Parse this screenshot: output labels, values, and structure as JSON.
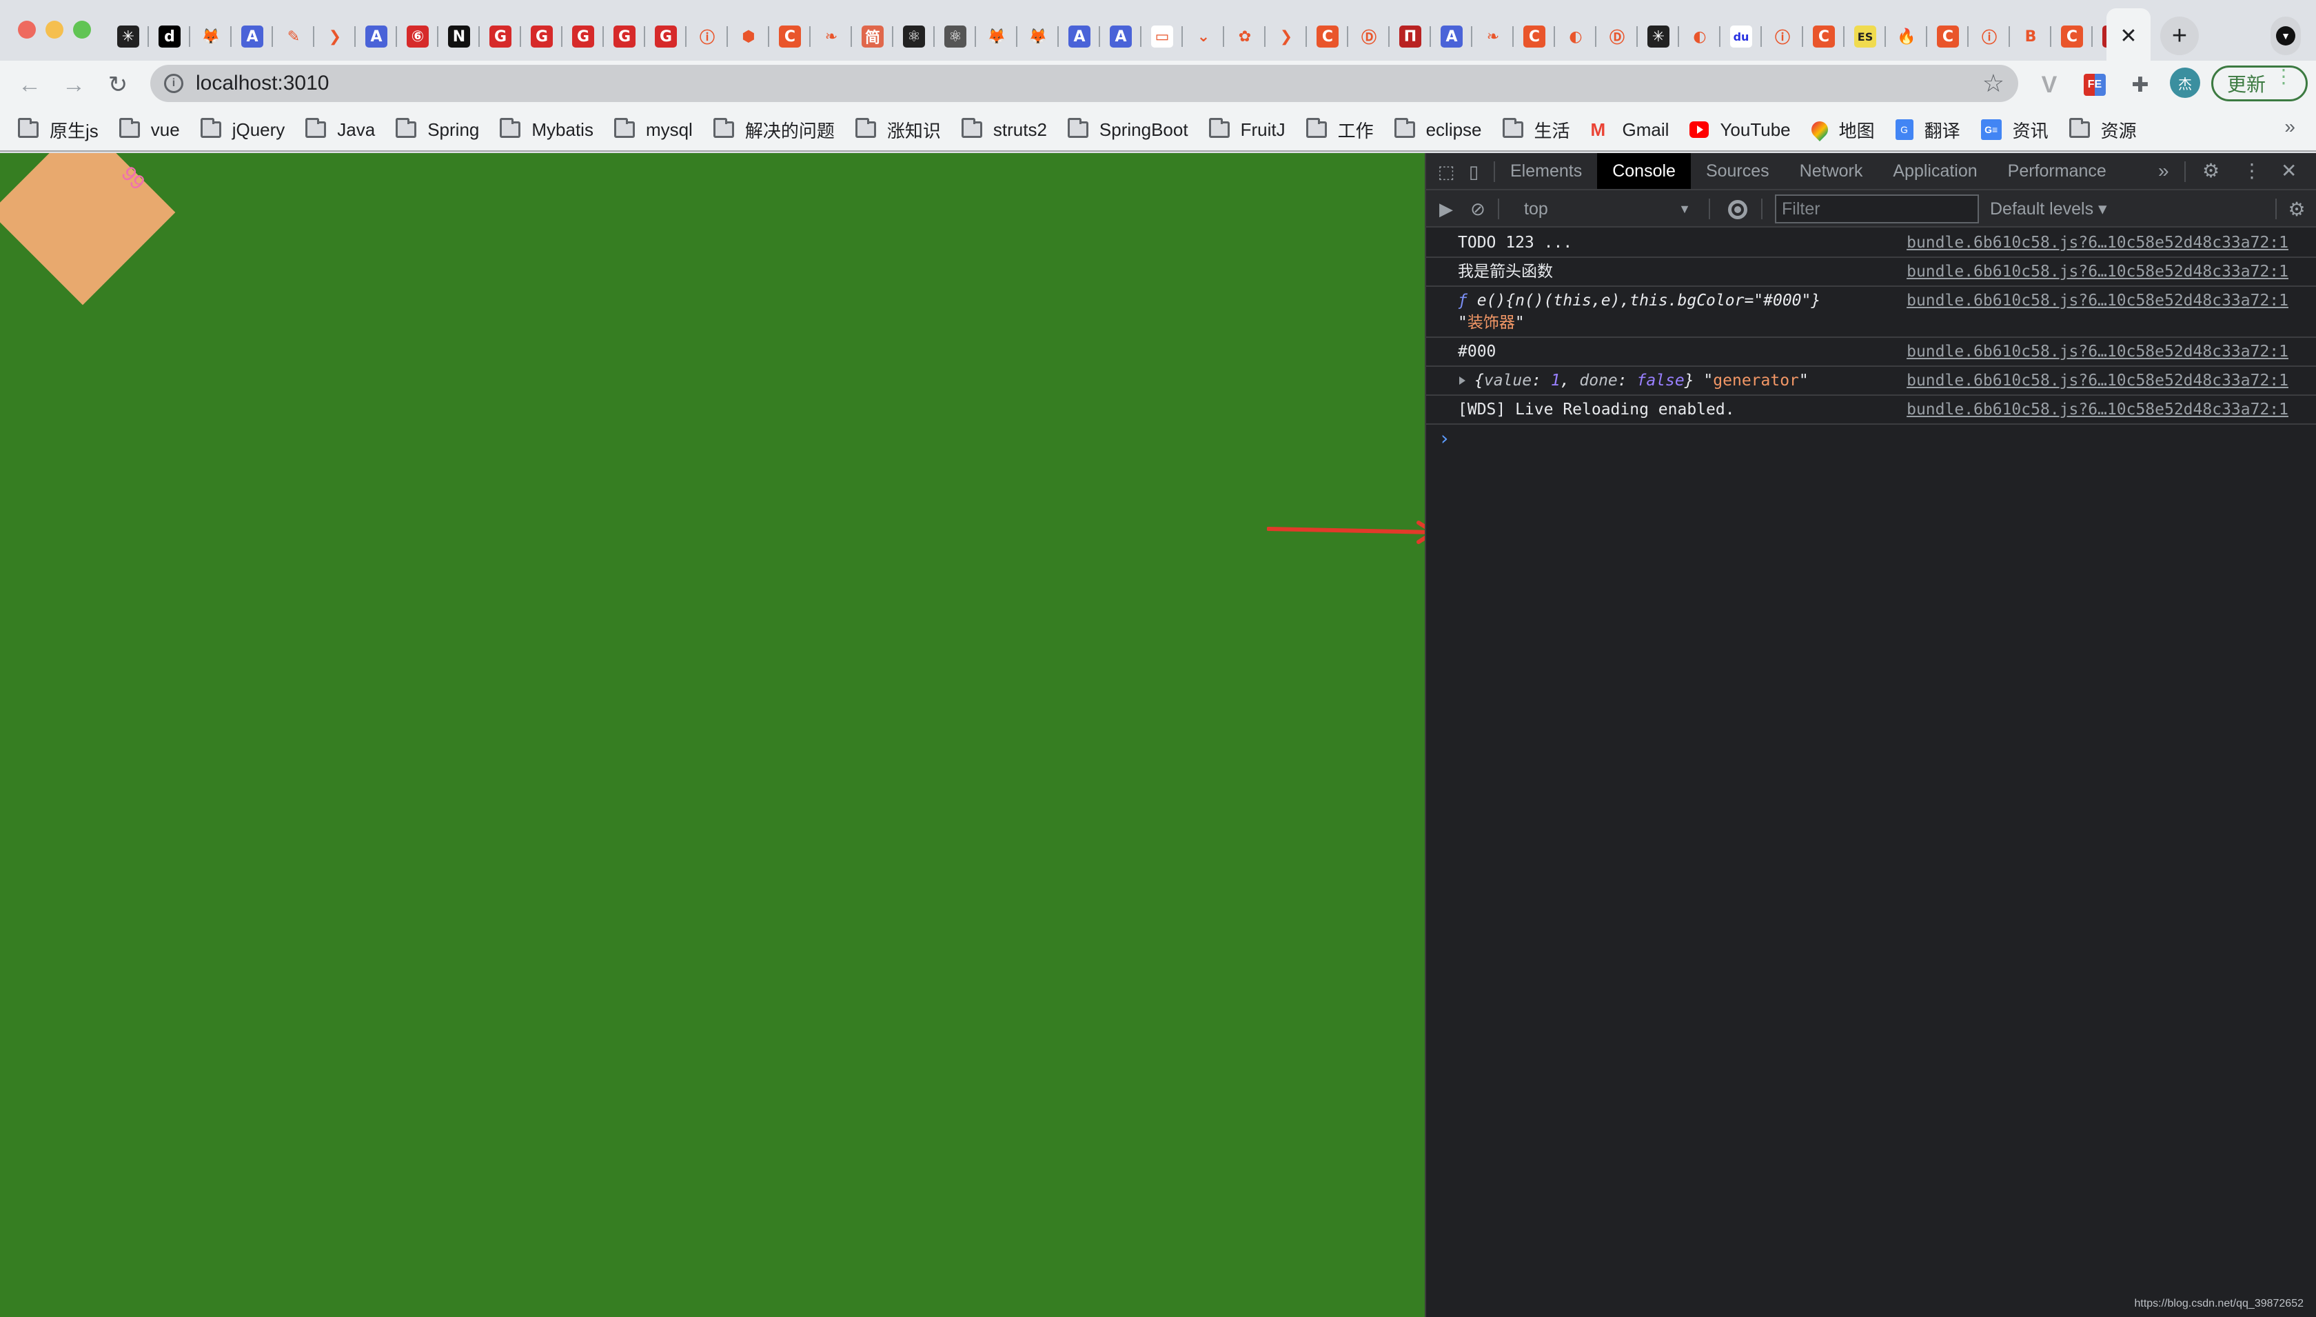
{
  "browser": {
    "tabs": [
      {
        "favicon": "medusa-icon",
        "bg": "#222",
        "glyph": "✳"
      },
      {
        "favicon": "done-icon",
        "bg": "#000",
        "glyph": "d"
      },
      {
        "favicon": "gitlab-icon",
        "bg": "transparent",
        "glyph": "🦊"
      },
      {
        "favicon": "a-blue-icon",
        "bg": "#4a63d8",
        "glyph": "A"
      },
      {
        "favicon": "quill-icon",
        "bg": "transparent",
        "glyph": "✎"
      },
      {
        "favicon": "yellow-bird-icon",
        "bg": "transparent",
        "glyph": "❯"
      },
      {
        "favicon": "a-blue-icon",
        "bg": "#4a63d8",
        "glyph": "A"
      },
      {
        "favicon": "netease-music-icon",
        "bg": "#d62a2a",
        "glyph": "⑥"
      },
      {
        "favicon": "n-logo-icon",
        "bg": "#111",
        "glyph": "N"
      },
      {
        "favicon": "g-red-icon",
        "bg": "#d62a2a",
        "glyph": "G"
      },
      {
        "favicon": "g-red-icon",
        "bg": "#d62a2a",
        "glyph": "G"
      },
      {
        "favicon": "g-red-icon",
        "bg": "#d62a2a",
        "glyph": "G"
      },
      {
        "favicon": "g-red-icon",
        "bg": "#d62a2a",
        "glyph": "G"
      },
      {
        "favicon": "g-red-icon",
        "bg": "#d62a2a",
        "glyph": "G"
      },
      {
        "favicon": "faded-logo-icon",
        "bg": "transparent",
        "glyph": "ⓘ"
      },
      {
        "favicon": "webpack-icon",
        "bg": "transparent",
        "glyph": "⬢"
      },
      {
        "favicon": "csdn-icon",
        "bg": "#e9552b",
        "glyph": "C"
      },
      {
        "favicon": "green-bird-icon",
        "bg": "transparent",
        "glyph": "❧"
      },
      {
        "favicon": "jianshu-icon",
        "bg": "#e0674b",
        "glyph": "简"
      },
      {
        "favicon": "react-icon",
        "bg": "#222",
        "glyph": "⚛"
      },
      {
        "favicon": "react-gray-icon",
        "bg": "#555",
        "glyph": "⚛"
      },
      {
        "favicon": "gitlab-icon",
        "bg": "transparent",
        "glyph": "🦊"
      },
      {
        "favicon": "gitlab-icon",
        "bg": "transparent",
        "glyph": "🦊"
      },
      {
        "favicon": "a-blue-icon",
        "bg": "#4a63d8",
        "glyph": "A"
      },
      {
        "favicon": "a-blue-icon",
        "bg": "#4a63d8",
        "glyph": "A"
      },
      {
        "favicon": "file-icon",
        "bg": "#fff",
        "glyph": "▭"
      },
      {
        "favicon": "download-chevron-icon",
        "bg": "transparent",
        "glyph": "⌄"
      },
      {
        "favicon": "huawei-icon",
        "bg": "transparent",
        "glyph": "✿"
      },
      {
        "favicon": "orange-bird-icon",
        "bg": "transparent",
        "glyph": "❯"
      },
      {
        "favicon": "csdn-icon",
        "bg": "#e9552b",
        "glyph": "C"
      },
      {
        "favicon": "d-circle-icon",
        "bg": "transparent",
        "glyph": "Ⓓ"
      },
      {
        "favicon": "n-red-icon",
        "bg": "#b92222",
        "glyph": "Π"
      },
      {
        "favicon": "a-blue-icon",
        "bg": "#4a63d8",
        "glyph": "A"
      },
      {
        "favicon": "green-bird-icon",
        "bg": "transparent",
        "glyph": "❧"
      },
      {
        "favicon": "csdn-icon",
        "bg": "#e9552b",
        "glyph": "C"
      },
      {
        "favicon": "globe-icon",
        "bg": "transparent",
        "glyph": "◐"
      },
      {
        "favicon": "d-circle-icon",
        "bg": "transparent",
        "glyph": "Ⓓ"
      },
      {
        "favicon": "medusa-icon",
        "bg": "#222",
        "glyph": "✳"
      },
      {
        "favicon": "globe-icon",
        "bg": "transparent",
        "glyph": "◐"
      },
      {
        "favicon": "baidu-icon",
        "bg": "#fff",
        "glyph": "du"
      },
      {
        "favicon": "faded-logo-icon",
        "bg": "transparent",
        "glyph": "ⓘ"
      },
      {
        "favicon": "csdn-icon",
        "bg": "#e9552b",
        "glyph": "C"
      },
      {
        "favicon": "es-icon",
        "bg": "#f0db4f",
        "glyph": "ES"
      },
      {
        "favicon": "flame-icon",
        "bg": "transparent",
        "glyph": "🔥"
      },
      {
        "favicon": "csdn-icon",
        "bg": "#e9552b",
        "glyph": "C"
      },
      {
        "favicon": "faded-logo-icon",
        "bg": "transparent",
        "glyph": "ⓘ"
      },
      {
        "favicon": "b-script-icon",
        "bg": "transparent",
        "glyph": "B"
      },
      {
        "favicon": "csdn-icon",
        "bg": "#e9552b",
        "glyph": "C"
      },
      {
        "favicon": "n-red-icon",
        "bg": "#b92222",
        "glyph": "Π"
      }
    ],
    "active_tab_close": "✕",
    "new_tab": "+",
    "tab_search": "▼",
    "nav": {
      "back": "←",
      "forward": "→",
      "reload": "↻"
    },
    "url": "localhost:3010",
    "info_icon": "i",
    "bookmark_star": "☆",
    "extensions": {
      "vue": "V",
      "fe": "FE",
      "puzzle": "✚"
    },
    "avatar_label": "杰",
    "update_button": "更新",
    "update_menu": "⋮",
    "bookmarks": [
      {
        "type": "folder",
        "label": "原生js"
      },
      {
        "type": "folder",
        "label": "vue"
      },
      {
        "type": "folder",
        "label": "jQuery"
      },
      {
        "type": "folder",
        "label": "Java"
      },
      {
        "type": "folder",
        "label": "Spring"
      },
      {
        "type": "folder",
        "label": "Mybatis"
      },
      {
        "type": "folder",
        "label": "mysql"
      },
      {
        "type": "folder",
        "label": "解决的问题"
      },
      {
        "type": "folder",
        "label": "涨知识"
      },
      {
        "type": "folder",
        "label": "struts2"
      },
      {
        "type": "folder",
        "label": "SpringBoot"
      },
      {
        "type": "folder",
        "label": "FruitJ"
      },
      {
        "type": "folder",
        "label": "工作"
      },
      {
        "type": "folder",
        "label": "eclipse"
      },
      {
        "type": "folder",
        "label": "生活"
      },
      {
        "type": "gmail",
        "label": "Gmail"
      },
      {
        "type": "yt",
        "label": "YouTube"
      },
      {
        "type": "maps",
        "label": "地图"
      },
      {
        "type": "translate",
        "label": "翻译"
      },
      {
        "type": "news",
        "label": "资讯"
      },
      {
        "type": "folder",
        "label": "资源"
      }
    ],
    "bookmarks_overflow": "»"
  },
  "page": {
    "background": "#367e22",
    "diamond_color": "#e8a96e",
    "diamond_text": "99",
    "arrow_color": "#e23a2a"
  },
  "devtools": {
    "panels": [
      {
        "label": "Elements",
        "active": false
      },
      {
        "label": "Console",
        "active": true
      },
      {
        "label": "Sources",
        "active": false
      },
      {
        "label": "Network",
        "active": false
      },
      {
        "label": "Application",
        "active": false
      },
      {
        "label": "Performance",
        "active": false
      }
    ],
    "more_panels": "»",
    "settings_icon": "⚙",
    "menu_icon": "⋮",
    "close_icon": "✕",
    "console_toolbar": {
      "context": "top",
      "filter_placeholder": "Filter",
      "filter_value": "",
      "levels": "Default levels ▾"
    },
    "messages": [
      {
        "text": "TODO 123 ...",
        "source": "bundle.6b610c58.js?6…10c58e52d48c33a72:1"
      },
      {
        "text": "我是箭头函数",
        "source": "bundle.6b610c58.js?6…10c58e52d48c33a72:1"
      },
      {
        "fn_keyword": "ƒ",
        "fn_body": "e(){n()(this,e),this.bgColor=\"#000\"}",
        "string": "装饰器",
        "source": "bundle.6b610c58.js?6…10c58e52d48c33a72:1"
      },
      {
        "text": "#000",
        "source": "bundle.6b610c58.js?6…10c58e52d48c33a72:1"
      },
      {
        "obj_open": "{",
        "key1": "value",
        "val1": "1",
        "key2": "done",
        "val2": "false",
        "obj_close": "}",
        "string": "generator",
        "source": "bundle.6b610c58.js?6…10c58e52d48c33a72:1"
      },
      {
        "text": "[WDS] Live Reloading enabled.",
        "source": "bundle.6b610c58.js?6…10c58e52d48c33a72:1"
      }
    ],
    "prompt": "›"
  },
  "watermark": "https://blog.csdn.net/qq_39872652"
}
